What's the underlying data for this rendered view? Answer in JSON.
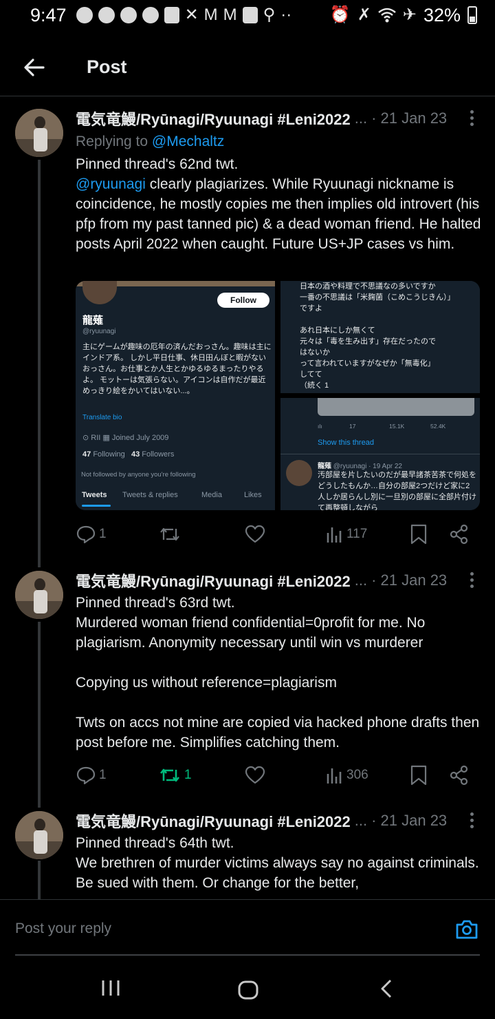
{
  "status_bar": {
    "time": "9:47",
    "battery_pct": "32%",
    "icons": [
      "messenger-icon",
      "messenger-icon",
      "headset-icon",
      "reddit-icon",
      "twitch-icon",
      "x-icon",
      "gmail-icon",
      "gmail-icon",
      "chat-icon",
      "person-icon",
      "more-dots-icon",
      "alarm-icon",
      "mute-icon",
      "wifi-icon",
      "airplane-icon",
      "battery-charging-icon"
    ]
  },
  "header": {
    "title": "Post"
  },
  "tweets": [
    {
      "name": "電気竜鰻/Ryūnagi/Ryuunagi #Leni2022",
      "ellipsis": "...",
      "date": "· 21 Jan 23",
      "replying_prefix": "Replying to ",
      "replying_handle": "@Mechaltz",
      "text_line1": "Pinned thread's 62nd twt.",
      "mention": "@ryuunagi",
      "text_rest": " clearly plagiarizes. While Ryuunagi nickname is coincidence, he mostly copies me then implies old introvert (his pfp from my past tanned pic) & a dead woman friend. He halted posts April 2022 when caught. Future US+JP cases vs him.",
      "replies": "1",
      "reposts": "",
      "likes": "",
      "views": "117"
    },
    {
      "name": "電気竜鰻/Ryūnagi/Ryuunagi #Leni2022",
      "ellipsis": "...",
      "date": "· 21 Jan 23",
      "text": "Pinned thread's 63rd twt.\nMurdered woman friend confidential=0profit for me. No plagiarism. Anonymity necessary until win vs murderer\n\nCopying us without reference=plagiarism\n\nTwts on accs not mine are copied via hacked phone drafts then post before me. Simplifies catching them.",
      "replies": "1",
      "reposts": "1",
      "likes": "",
      "views": "306"
    },
    {
      "name": "電気竜鰻/Ryūnagi/Ryuunagi #Leni2022",
      "ellipsis": "...",
      "date": "· 21 Jan 23",
      "text": "Pinned thread's 64th twt.\nWe brethren of murder victims always say no against criminals. Be sued with them. Or change for the better,"
    }
  ],
  "media": {
    "profile": {
      "follow_label": "Follow",
      "name": "龍薙",
      "handle": "@ryuunagi",
      "bio": "主にゲームが趣味の厄年の済んだおっさん。趣味は主にインドア系。 しかし平日仕事、休日田んぼと暇がないおっさん。お仕事とか人生とかゆるゆるまったりやるよ。 モットーは気張らない。アイコンは自作だが最近めっきり絵をかいてはいない...。",
      "translate": "Translate bio",
      "location": "RII",
      "joined": "Joined July 2009",
      "following_count": "47",
      "following_label": "Following",
      "followers_count": "43",
      "followers_label": "Followers",
      "not_followed": "Not followed by anyone you're following",
      "tabs": [
        "Tweets",
        "Tweets & replies",
        "Media",
        "Likes"
      ]
    },
    "top_right_text": "日本の酒や料理で不思議なの多いですか\n一番の不思議は「米麹菌（こめこうじきん）」ですよ\n\nあれ日本にしか無くて\n元々は「毒を生み出す」存在だったので\nはないか\nって言われていますがなぜか「無毒化」\nしてて\n（続く 1",
    "bottom_right": {
      "stat_replies": "17",
      "stat_retweets": "15.1K",
      "stat_likes": "52.4K",
      "show_thread": "Show this thread",
      "author": "龍薙",
      "author_meta": "@ryuunagi · 19 Apr 22",
      "text": "汚部屋を片したいのだが最早諸茶苦茶で何処をどうしたもんか…自分の部屋2つだけど家に2人しか居らんし別に一旦別の部屋に全部片付けて再整頓しながら"
    }
  },
  "reply_bar": {
    "placeholder": "Post your reply"
  },
  "colors": {
    "accent": "#1d9bf0",
    "repost_active": "#00ba7c",
    "muted": "#71767b",
    "background": "#000000"
  }
}
